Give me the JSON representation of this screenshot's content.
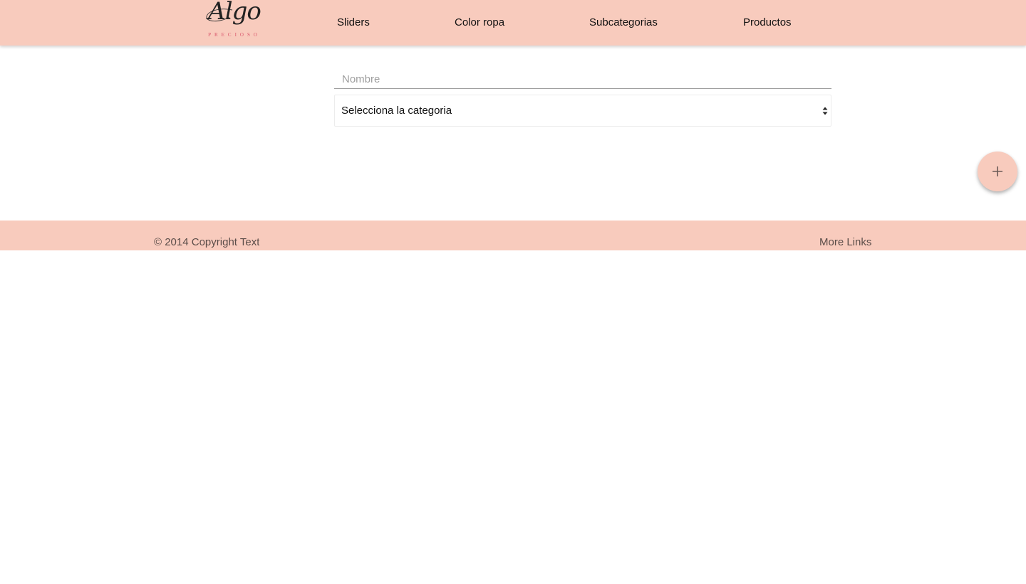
{
  "header": {
    "logo": {
      "script_text": "Algo",
      "sub_text": "PRECIOSO"
    },
    "nav": [
      {
        "label": "Sliders"
      },
      {
        "label": "Color ropa"
      },
      {
        "label": "Subcategorias"
      },
      {
        "label": "Productos"
      }
    ]
  },
  "form": {
    "name_field": {
      "placeholder": "Nombre",
      "value": ""
    },
    "category_select": {
      "selected": "Selecciona la categoria"
    }
  },
  "fab": {
    "icon": "plus-icon"
  },
  "footer": {
    "copyright": "© 2014 Copyright Text",
    "links_label": "More Links"
  },
  "colors": {
    "brand": "#f8cbbd",
    "logo_accent": "#d9536a",
    "footer_text": "#5b4d49"
  }
}
